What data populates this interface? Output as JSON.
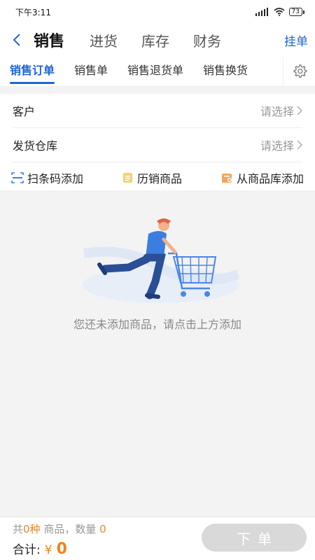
{
  "status_bar": {
    "time": "下午3:11",
    "battery": "73"
  },
  "header": {
    "tabs": [
      {
        "label": "销售",
        "active": true
      },
      {
        "label": "进货",
        "active": false
      },
      {
        "label": "库存",
        "active": false
      },
      {
        "label": "财务",
        "active": false
      }
    ],
    "hang_label": "挂单"
  },
  "sub_tabs": [
    {
      "label": "销售订单",
      "active": true
    },
    {
      "label": "销售单",
      "active": false
    },
    {
      "label": "销售退货单",
      "active": false
    },
    {
      "label": "销售换货",
      "active": false
    }
  ],
  "form": {
    "customer": {
      "label": "客户",
      "value": "请选择"
    },
    "warehouse": {
      "label": "发货仓库",
      "value": "请选择"
    }
  },
  "actions": {
    "scan": "扫条码添加",
    "history": "历销商品",
    "library": "从商品库添加"
  },
  "empty": {
    "message": "您还未添加商品，请点击上方添加"
  },
  "bottom": {
    "prefix": "共",
    "kinds": "0种",
    "mid": "商品，数量",
    "quantity": "0",
    "total_label": "合计:",
    "currency": "¥",
    "total": "0",
    "order_label": "下单"
  },
  "colors": {
    "accent": "#1f66d1",
    "orange": "#f08519",
    "disabled_button": "#d9d9d9"
  }
}
